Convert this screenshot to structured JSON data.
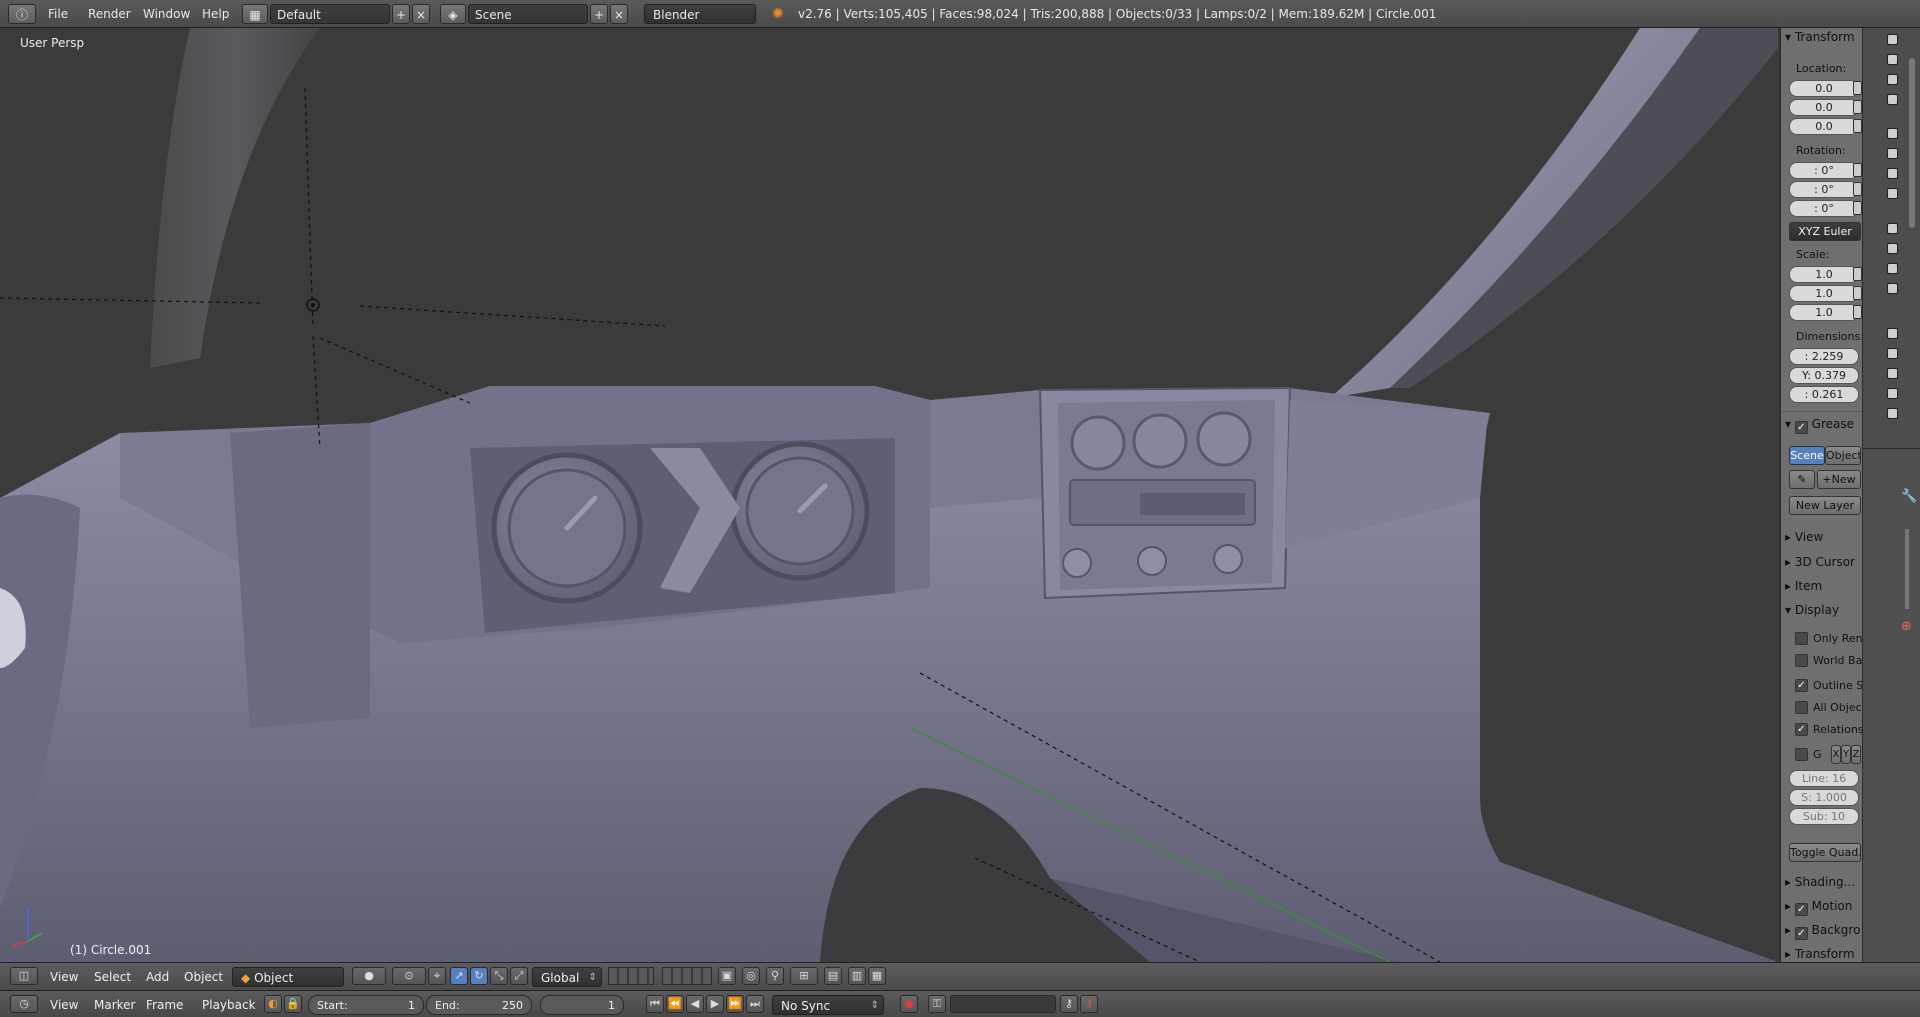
{
  "topbar": {
    "menu": [
      "File",
      "Render",
      "Window",
      "Help"
    ],
    "screen_layout": "Default",
    "scene": "Scene",
    "render_engine": "Blender Render",
    "stats": "v2.76 | Verts:105,405 | Faces:98,024 | Tris:200,888 | Objects:0/33 | Lamps:0/2 | Mem:189.62M | Circle.001"
  },
  "viewport": {
    "view_label": "User Persp",
    "object_label": "(1) Circle.001"
  },
  "npanel": {
    "transform": {
      "header": "Transform",
      "location_label": "Location:",
      "location": [
        "0.0",
        "0.0",
        "0.0"
      ],
      "rotation_label": "Rotation:",
      "rotation": [
        ": 0°",
        ": 0°",
        ": 0°"
      ],
      "rotation_mode": "XYZ Euler",
      "scale_label": "Scale:",
      "scale": [
        "1.0",
        "1.0",
        "1.0"
      ],
      "dimensions_label": "Dimensions:",
      "dimensions": [
        ": 2.259",
        "Y: 0.379",
        ": 0.261"
      ]
    },
    "grease": {
      "header": "Grease",
      "tab_scene": "Scene",
      "tab_object": "Object",
      "new_label": "New",
      "new_layer": "New Layer"
    },
    "collapsed_panels": [
      "View",
      "3D Cursor",
      "Item"
    ],
    "display": {
      "header": "Display",
      "checks": [
        {
          "label": "Only Ren",
          "checked": false
        },
        {
          "label": "World Ba",
          "checked": false
        },
        {
          "label": "Outline S",
          "checked": true
        },
        {
          "label": "All Objec",
          "checked": false
        },
        {
          "label": "Relations",
          "checked": true
        }
      ],
      "grid_label": "G",
      "axes": [
        "X",
        "Y",
        "Z"
      ],
      "grid_fields": [
        "Line: 16",
        "S: 1.000",
        "Sub: 10"
      ],
      "toggle_quad": "Toggle Quad..."
    },
    "bottom_panels": [
      {
        "label": "Shading...",
        "check": false
      },
      {
        "label": "Motion",
        "check": true
      },
      {
        "label": "Backgro",
        "check": true
      },
      {
        "label": "Transform",
        "check": false
      }
    ]
  },
  "viewheader": {
    "menu": [
      "View",
      "Select",
      "Add",
      "Object"
    ],
    "mode": "Object Mode",
    "orientation": "Global"
  },
  "timeline": {
    "menu": [
      "View",
      "Marker",
      "Frame",
      "Playback"
    ],
    "start_label": "Start:",
    "start_value": "1",
    "end_label": "End:",
    "end_value": "250",
    "current_frame": "1",
    "sync": "No Sync"
  }
}
